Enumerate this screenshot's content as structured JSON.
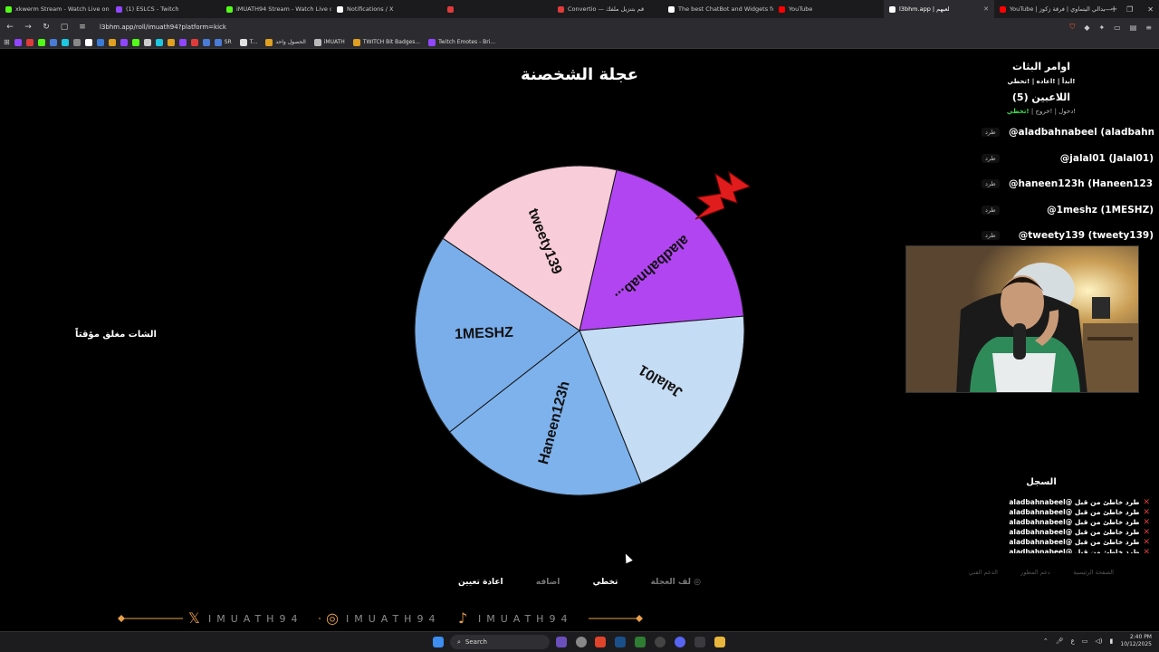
{
  "browser": {
    "tabs": [
      {
        "title": "xkwerm Stream - Watch Live on K",
        "color": "#53fc18",
        "active": false
      },
      {
        "title": "(1) ESLCS - Twitch",
        "color": "#9146ff",
        "active": false
      },
      {
        "title": "iMUATH94 Stream - Watch Live o",
        "color": "#53fc18",
        "active": false
      },
      {
        "title": "Notifications / X",
        "color": "#ffffff",
        "active": false
      },
      {
        "title": "",
        "color": "#e03b3b",
        "active": false
      },
      {
        "title": "Convertio — قم بتنزيل ملفك",
        "color": "#e03b3b",
        "active": false
      },
      {
        "title": "The best ChatBot and Widgets for K",
        "color": "#ffffff",
        "active": false
      },
      {
        "title": "YouTube",
        "color": "#ff0000",
        "active": false
      },
      {
        "title": "l3bhm.app | لعبهم",
        "color": "#ffffff",
        "active": true
      },
      {
        "title": "YouTube | ميدالي اليتماوي | فرقة زكوز",
        "color": "#ff0000",
        "active": false
      }
    ],
    "new_tab": "+",
    "url": "l3bhm.app/roll/imuath94?platform=kick",
    "bookmarks": [
      {
        "label": "SR",
        "color": "#4a7bd6"
      },
      {
        "label": "T...",
        "color": "#e0e0e0"
      },
      {
        "label": "الحصول واحد",
        "color": "#e0a020"
      },
      {
        "label": "iMUATH",
        "color": "#bbbbbb"
      },
      {
        "label": "TWITCH Bit Badges...",
        "color": "#e0a020"
      },
      {
        "label": "Twitch Emotes - Bri...",
        "color": "#9146ff"
      }
    ]
  },
  "page": {
    "title": "عجلة الشخصنة",
    "chat_closed": "الشات مغلق مؤقتاً"
  },
  "wheel": {
    "segments": [
      {
        "label": "aladbahnab...",
        "color": "#b245f2"
      },
      {
        "label": "Jalal01",
        "color": "#c5dcf5"
      },
      {
        "label": "Haneen123h",
        "color": "#7eb2ec"
      },
      {
        "label": "1MESHZ",
        "color": "#7aaeea"
      },
      {
        "label": "tweety139",
        "color": "#f8ccd8"
      }
    ],
    "pointer_color": "#e01c1c"
  },
  "panel": {
    "commands_title": "اوامر البثات",
    "commands_list": "!ابدأ | !اعاده | !تخطي",
    "players_title": "اللاعبين (5)",
    "players_cmds_prefix": "!دخول | !خروج |",
    "players_cmds_highlight": "!تخطي",
    "kick_label": "طرد",
    "players": [
      "@aladbahnabeel (aladbahna...",
      "@jalal01 (Jalal01)",
      "@haneen123h (Haneen123h)",
      "@1meshz (1MESHZ)",
      "@tweety139 (tweety139)"
    ],
    "log_title": "السجل",
    "log_entries": [
      "aladbahnabeel@ طرد خاطئ من قبل",
      "aladbahnabeel@ طرد خاطئ من قبل",
      "aladbahnabeel@ طرد خاطئ من قبل",
      "aladbahnabeel@ طرد خاطئ من قبل",
      "aladbahnabeel@ طرد خاطئ من قبل",
      "aladbahnabeel@ طرد خاطئ من قبل"
    ],
    "footer_links": [
      "الصفحة الرئيسية",
      "دعم المطور",
      "الدعم الفني"
    ]
  },
  "controls": {
    "spin": "لف العجلة",
    "skip": "تخطي",
    "add": "اضافه",
    "reset": "اعادة تعيين"
  },
  "social": {
    "handle": "IMUATH94",
    "accent": "#e8a04a"
  },
  "taskbar": {
    "search": "Search",
    "time": "2:40 PM",
    "date": "10/12/2025",
    "lang": "ع"
  }
}
